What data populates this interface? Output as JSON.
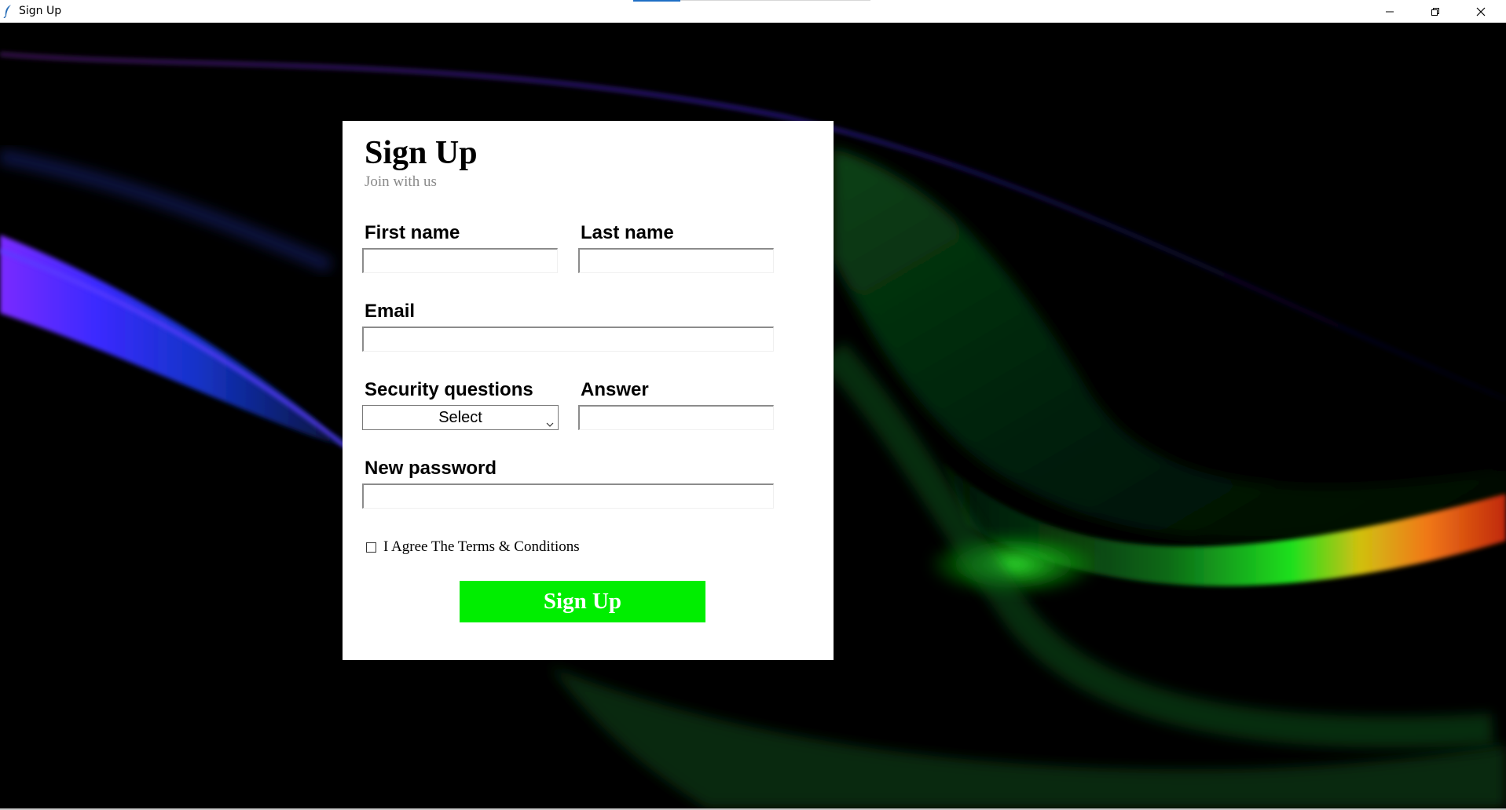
{
  "window": {
    "title": "Sign Up",
    "controls": {
      "minimize_icon": "minimize-icon",
      "maximize_icon": "restore-icon",
      "close_icon": "close-icon"
    }
  },
  "form": {
    "heading": "Sign Up",
    "subheading": "Join with us",
    "first_name": {
      "label": "First name",
      "value": ""
    },
    "last_name": {
      "label": "Last name",
      "value": ""
    },
    "email": {
      "label": "Email",
      "value": ""
    },
    "security_question": {
      "label": "Security questions",
      "selected": "Select"
    },
    "answer": {
      "label": "Answer",
      "value": ""
    },
    "new_password": {
      "label": "New password",
      "value": ""
    },
    "terms": {
      "label": "I Agree The Terms & Conditions",
      "checked": false
    },
    "submit_label": "Sign Up"
  },
  "colors": {
    "background": "#000000",
    "card": "#ffffff",
    "submit_button": "#00ee00",
    "subheading": "#8a8a8a"
  }
}
